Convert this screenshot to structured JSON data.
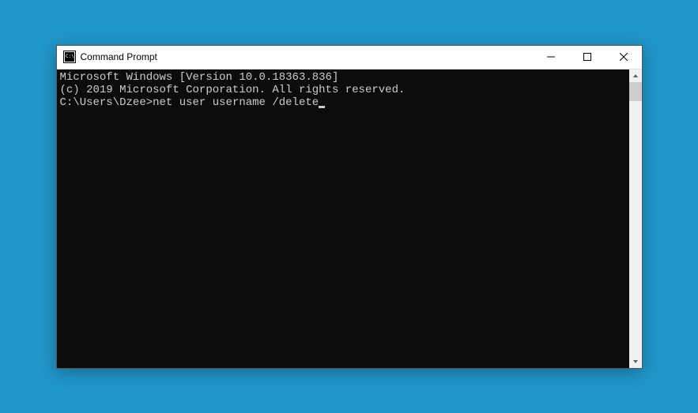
{
  "titlebar": {
    "title": "Command Prompt"
  },
  "terminal": {
    "line1": "Microsoft Windows [Version 10.0.18363.836]",
    "line2": "(c) 2019 Microsoft Corporation. All rights reserved.",
    "blank": "",
    "prompt": "C:\\Users\\Dzee>",
    "command": "net user username /delete"
  }
}
